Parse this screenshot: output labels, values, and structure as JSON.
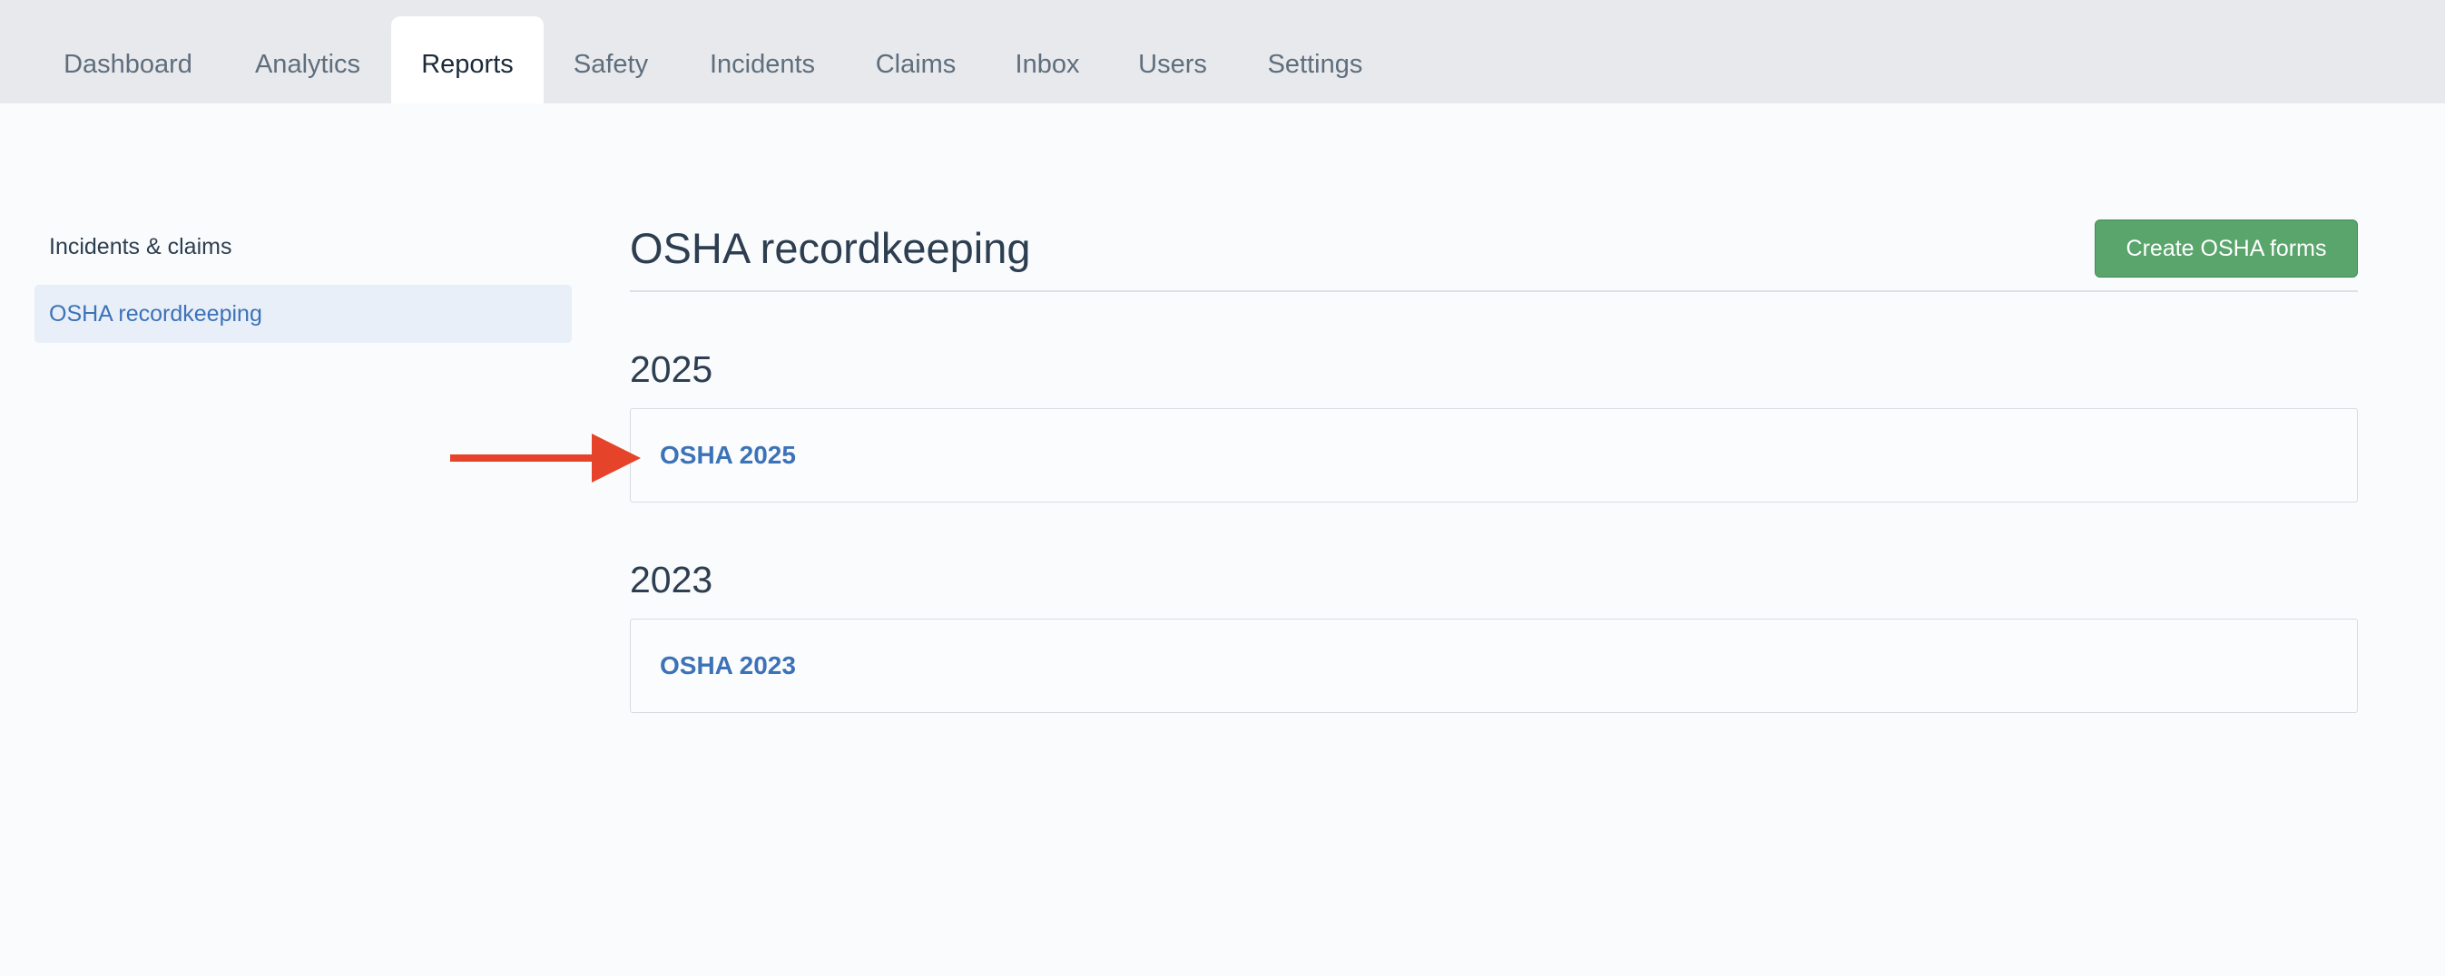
{
  "nav": {
    "tabs": [
      {
        "label": "Dashboard"
      },
      {
        "label": "Analytics"
      },
      {
        "label": "Reports"
      },
      {
        "label": "Safety"
      },
      {
        "label": "Incidents"
      },
      {
        "label": "Claims"
      },
      {
        "label": "Inbox"
      },
      {
        "label": "Users"
      },
      {
        "label": "Settings"
      }
    ],
    "active_tab": "Reports"
  },
  "sidebar": {
    "heading": "Incidents & claims",
    "items": [
      {
        "label": "OSHA recordkeeping",
        "selected": true
      }
    ]
  },
  "main": {
    "title": "OSHA recordkeeping",
    "create_button_label": "Create OSHA forms",
    "years": [
      {
        "year": "2025",
        "report_label": "OSHA 2025"
      },
      {
        "year": "2023",
        "report_label": "OSHA 2023"
      }
    ]
  },
  "colors": {
    "accent_link": "#3c72b8",
    "create_button": "#5aa56c",
    "annotation_arrow": "#e5432a",
    "nav_background": "#e7e9ec"
  }
}
